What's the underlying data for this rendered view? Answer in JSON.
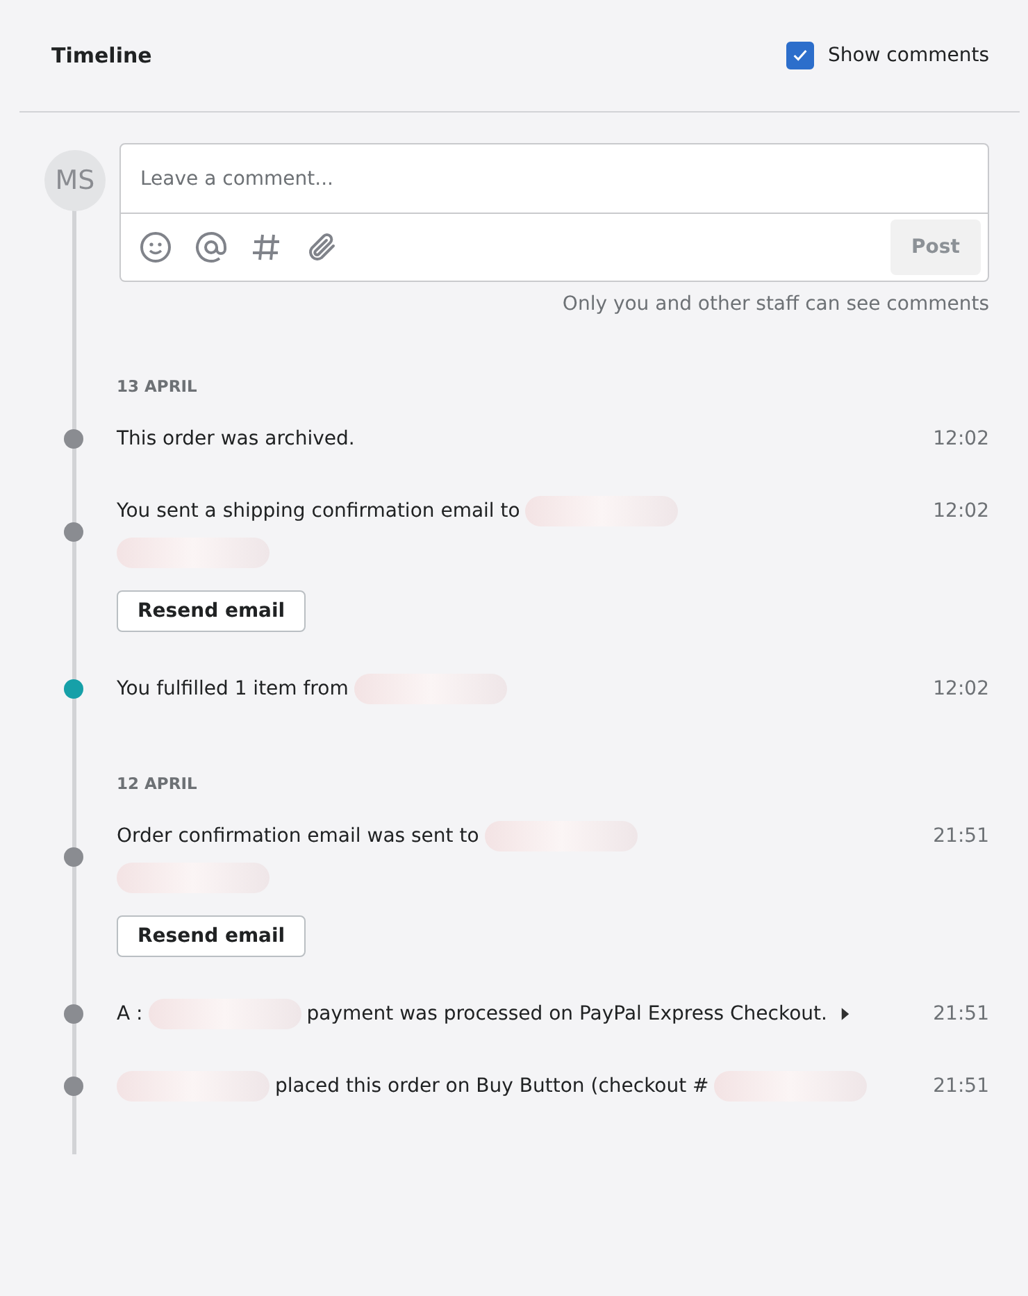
{
  "header": {
    "title": "Timeline",
    "show_comments": {
      "label": "Show comments",
      "checked": true
    }
  },
  "composer": {
    "avatar": "MS",
    "placeholder": "Leave a comment...",
    "post_button": "Post",
    "note": "Only you and other staff can see comments"
  },
  "groups": [
    {
      "date": "13 APRIL",
      "events": [
        {
          "parts": [
            {
              "kind": "text",
              "text": "This order was archived."
            }
          ],
          "time": "12:02",
          "color": "#8a8c91"
        },
        {
          "parts": [
            {
              "kind": "text",
              "text": "You sent a shipping confirmation email to"
            },
            {
              "kind": "redacted"
            },
            {
              "kind": "break"
            },
            {
              "kind": "redacted"
            }
          ],
          "time": "12:02",
          "color": "#8a8c91",
          "button": "Resend email"
        },
        {
          "parts": [
            {
              "kind": "text",
              "text": "You fulfilled 1 item from"
            },
            {
              "kind": "redacted"
            }
          ],
          "time": "12:02",
          "color": "#16a0a8"
        }
      ]
    },
    {
      "date": "12 APRIL",
      "events": [
        {
          "parts": [
            {
              "kind": "text",
              "text": "Order confirmation email was sent to"
            },
            {
              "kind": "redacted"
            },
            {
              "kind": "break"
            },
            {
              "kind": "redacted"
            }
          ],
          "time": "21:51",
          "color": "#8a8c91",
          "button": "Resend email"
        },
        {
          "parts": [
            {
              "kind": "text",
              "text": "A :"
            },
            {
              "kind": "redacted"
            },
            {
              "kind": "text",
              "text": "payment was processed on PayPal Express Checkout."
            }
          ],
          "time": "21:51",
          "color": "#8a8c91",
          "expandable": true
        },
        {
          "parts": [
            {
              "kind": "redacted"
            },
            {
              "kind": "text",
              "text": "placed this order on Buy Button (checkout #"
            },
            {
              "kind": "redacted"
            }
          ],
          "time": "21:51",
          "color": "#8a8c91"
        }
      ]
    }
  ]
}
